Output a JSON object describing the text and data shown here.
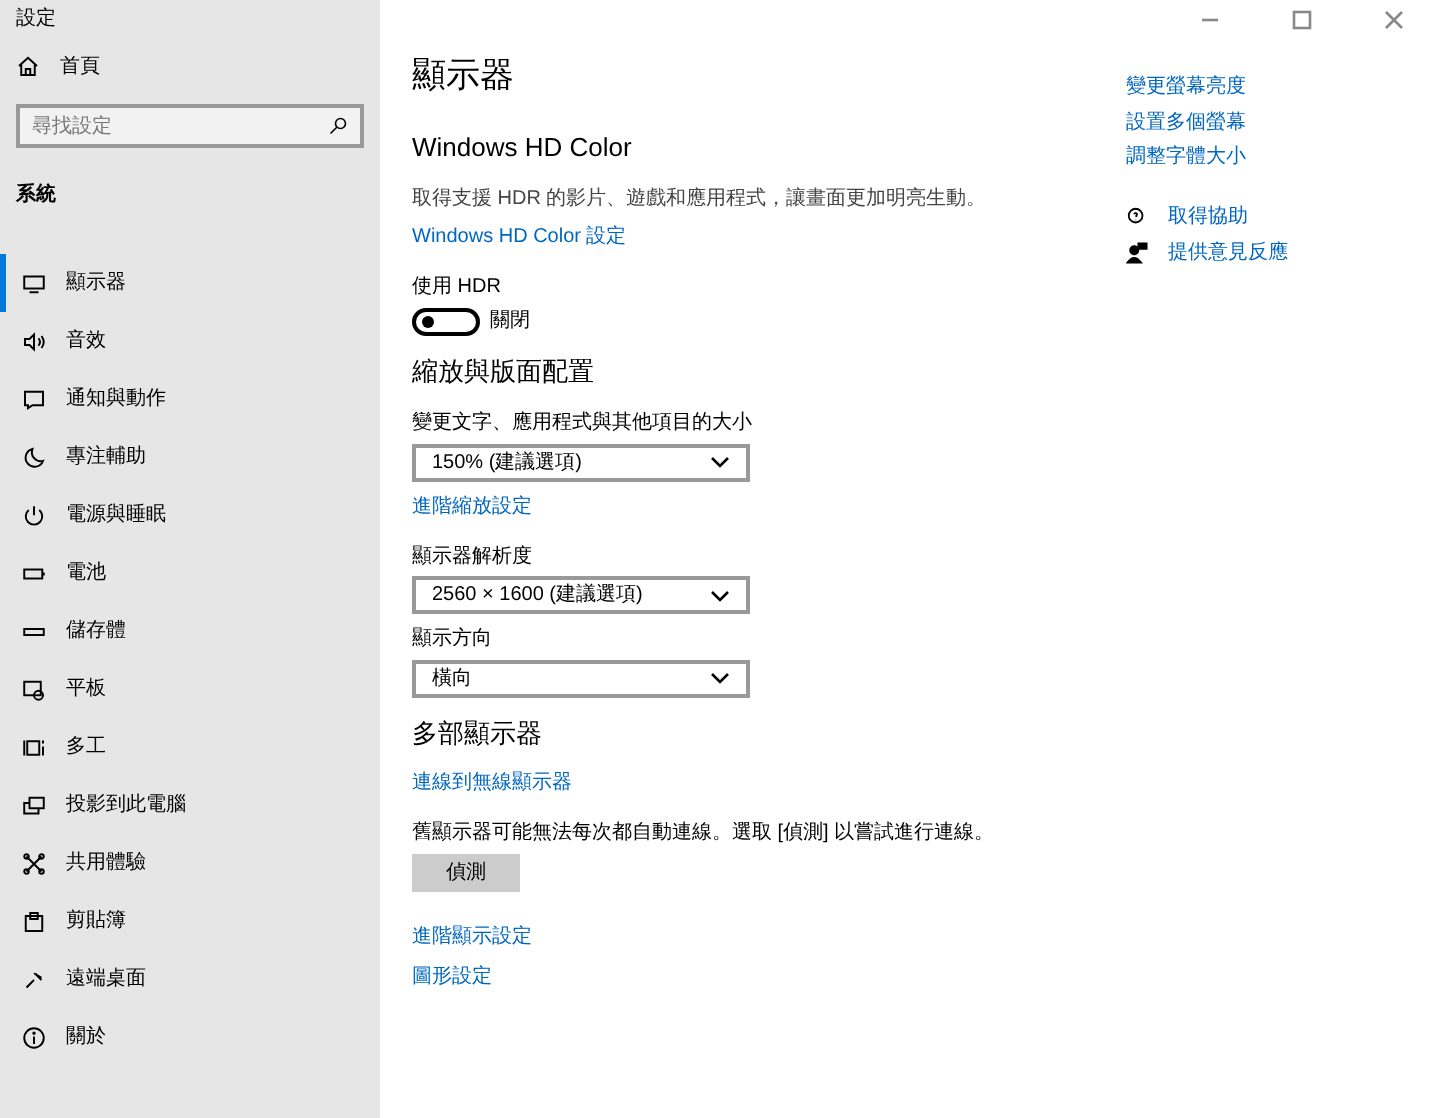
{
  "window": {
    "title": "設定"
  },
  "sidebar": {
    "home": "首頁",
    "search": {
      "placeholder": "尋找設定"
    },
    "section": "系統",
    "items": [
      {
        "label": "顯示器",
        "selected": true
      },
      {
        "label": "音效",
        "selected": false
      },
      {
        "label": "通知與動作",
        "selected": false
      },
      {
        "label": "專注輔助",
        "selected": false
      },
      {
        "label": "電源與睡眠",
        "selected": false
      },
      {
        "label": "電池",
        "selected": false
      },
      {
        "label": "儲存體",
        "selected": false
      },
      {
        "label": "平板",
        "selected": false
      },
      {
        "label": "多工",
        "selected": false
      },
      {
        "label": "投影到此電腦",
        "selected": false
      },
      {
        "label": "共用體驗",
        "selected": false
      },
      {
        "label": "剪貼簿",
        "selected": false
      },
      {
        "label": "遠端桌面",
        "selected": false
      },
      {
        "label": "關於",
        "selected": false
      }
    ]
  },
  "page_title": "顯示器",
  "hd_color": {
    "heading": "Windows HD Color",
    "description": "取得支援 HDR 的影片、遊戲和應用程式，讓畫面更加明亮生動。",
    "link": "Windows HD Color 設定",
    "hdr_label": "使用 HDR",
    "hdr_toggle": {
      "on": false,
      "label": "關閉"
    }
  },
  "scale_layout": {
    "heading": "縮放與版面配置",
    "items": [
      {
        "kind": "dropdown",
        "label": "變更文字、應用程式與其他項目的大小",
        "value": "150% (建議選項)"
      },
      {
        "kind": "link",
        "label": "進階縮放設定"
      },
      {
        "kind": "dropdown",
        "label": "顯示器解析度",
        "value": "2560 × 1600 (建議選項)"
      },
      {
        "kind": "dropdown",
        "label": "顯示方向",
        "value": "橫向"
      }
    ]
  },
  "multiple_displays": {
    "heading": "多部顯示器",
    "link": "連線到無線顯示器",
    "note": "舊顯示器可能無法每次都自動連線。選取 [偵測] 以嘗試進行連線。",
    "button": "偵測",
    "links": [
      "進階顯示設定",
      "圖形設定"
    ]
  },
  "related_links": [
    "變更螢幕亮度",
    "設置多個螢幕",
    "調整字體大小"
  ],
  "help": [
    "取得協助",
    "提供意見反應"
  ]
}
